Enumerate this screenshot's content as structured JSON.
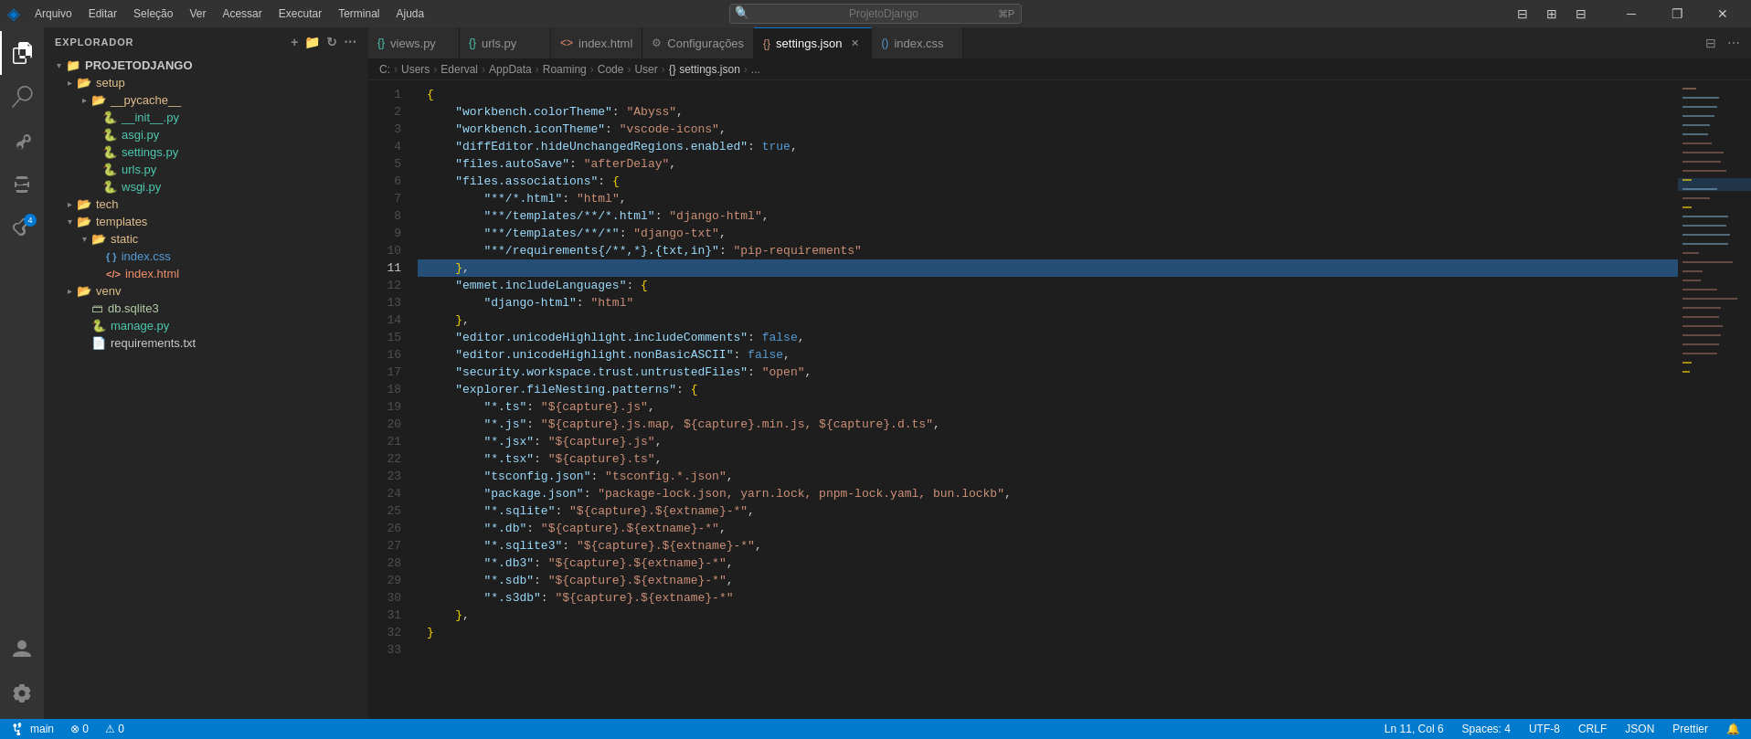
{
  "titlebar": {
    "logo": "◈",
    "menu_items": [
      "Arquivo",
      "Editar",
      "Seleção",
      "Ver",
      "Acessar",
      "Executar",
      "Terminal",
      "Ajuda"
    ],
    "search_placeholder": "ProjetoDjango",
    "win_minimize": "─",
    "win_restore": "❐",
    "win_close": "✕"
  },
  "activity_bar": {
    "icons": [
      {
        "name": "explorer-icon",
        "symbol": "⎗",
        "active": true
      },
      {
        "name": "search-icon",
        "symbol": "🔍",
        "active": false
      },
      {
        "name": "source-control-icon",
        "symbol": "⎇",
        "active": false
      },
      {
        "name": "run-debug-icon",
        "symbol": "▷",
        "active": false
      },
      {
        "name": "extensions-icon",
        "symbol": "⊞",
        "active": false,
        "badge": "4"
      }
    ],
    "bottom_icons": [
      {
        "name": "accounts-icon",
        "symbol": "👤"
      },
      {
        "name": "settings-icon",
        "symbol": "⚙"
      }
    ]
  },
  "sidebar": {
    "header": "EXPLORADOR",
    "header_actions": [
      "⋯"
    ],
    "project_name": "PROJETODJANGO",
    "tree": [
      {
        "id": "setup",
        "label": "setup",
        "type": "folder",
        "depth": 1,
        "expanded": false
      },
      {
        "id": "pycache",
        "label": "__pycache__",
        "type": "folder",
        "depth": 2,
        "expanded": false
      },
      {
        "id": "init",
        "label": "__init__.py",
        "type": "py",
        "depth": 2
      },
      {
        "id": "asgi",
        "label": "asgi.py",
        "type": "py",
        "depth": 2
      },
      {
        "id": "settings",
        "label": "settings.py",
        "type": "py",
        "depth": 2
      },
      {
        "id": "urls",
        "label": "urls.py",
        "type": "py",
        "depth": 2
      },
      {
        "id": "wsgi",
        "label": "wsgi.py",
        "type": "py",
        "depth": 2
      },
      {
        "id": "tech",
        "label": "tech",
        "type": "folder",
        "depth": 1,
        "expanded": false
      },
      {
        "id": "templates",
        "label": "templates",
        "type": "folder",
        "depth": 1,
        "expanded": true
      },
      {
        "id": "static",
        "label": "static",
        "type": "folder",
        "depth": 2,
        "expanded": true
      },
      {
        "id": "indexcss",
        "label": "index.css",
        "type": "css",
        "depth": 3
      },
      {
        "id": "indexhtml",
        "label": "index.html",
        "type": "html",
        "depth": 3
      },
      {
        "id": "venv",
        "label": "venv",
        "type": "folder",
        "depth": 1,
        "expanded": false
      },
      {
        "id": "dbsqlite3",
        "label": "db.sqlite3",
        "type": "db",
        "depth": 1
      },
      {
        "id": "managepy",
        "label": "manage.py",
        "type": "py",
        "depth": 1
      },
      {
        "id": "requirementstxt",
        "label": "requirements.txt",
        "type": "txt",
        "depth": 1
      }
    ]
  },
  "tabs": [
    {
      "id": "views",
      "label": "views.py",
      "icon": "{}",
      "active": false,
      "dirty": false
    },
    {
      "id": "urls",
      "label": "urls.py",
      "icon": "{}",
      "active": false,
      "dirty": false
    },
    {
      "id": "indexhtml",
      "label": "index.html",
      "icon": "<>",
      "active": false,
      "dirty": false
    },
    {
      "id": "configuracoes",
      "label": "Configurações",
      "icon": "⚙",
      "active": false,
      "dirty": false
    },
    {
      "id": "settingsjson",
      "label": "settings.json",
      "icon": "{}",
      "active": true,
      "dirty": false
    },
    {
      "id": "indexcss",
      "label": "index.css",
      "icon": "()",
      "active": false,
      "dirty": false
    }
  ],
  "breadcrumb": {
    "parts": [
      "C:",
      "Users",
      "Ederval",
      "AppData",
      "Roaming",
      "Code",
      "User",
      "{} settings.json",
      "..."
    ]
  },
  "code": {
    "lines": [
      {
        "num": 1,
        "content": "{",
        "highlighted": false
      },
      {
        "num": 2,
        "content": "    \"workbench.colorTheme\": \"Abyss\",",
        "highlighted": false
      },
      {
        "num": 3,
        "content": "    \"workbench.iconTheme\": \"vscode-icons\",",
        "highlighted": false
      },
      {
        "num": 4,
        "content": "    \"diffEditor.hideUnchangedRegions.enabled\": true,",
        "highlighted": false
      },
      {
        "num": 5,
        "content": "    \"files.autoSave\": \"afterDelay\",",
        "highlighted": false
      },
      {
        "num": 6,
        "content": "    \"files.associations\": {",
        "highlighted": false
      },
      {
        "num": 7,
        "content": "        \"**/*.html\": \"html\",",
        "highlighted": false
      },
      {
        "num": 8,
        "content": "        \"**/templates/**/*.html\": \"django-html\",",
        "highlighted": false
      },
      {
        "num": 9,
        "content": "        \"**/templates/**/*\": \"django-txt\",",
        "highlighted": false
      },
      {
        "num": 10,
        "content": "        \"**/requirements{/**,*}.{txt,in}\": \"pip-requirements\"",
        "highlighted": false
      },
      {
        "num": 11,
        "content": "    },",
        "highlighted": true
      },
      {
        "num": 12,
        "content": "    \"emmet.includeLanguages\": {",
        "highlighted": false
      },
      {
        "num": 13,
        "content": "        \"django-html\": \"html\"",
        "highlighted": false
      },
      {
        "num": 14,
        "content": "    },",
        "highlighted": false
      },
      {
        "num": 15,
        "content": "    \"editor.unicodeHighlight.includeComments\": false,",
        "highlighted": false
      },
      {
        "num": 16,
        "content": "    \"editor.unicodeHighlight.nonBasicASCII\": false,",
        "highlighted": false
      },
      {
        "num": 17,
        "content": "    \"security.workspace.trust.untrustedFiles\": \"open\",",
        "highlighted": false
      },
      {
        "num": 18,
        "content": "    \"explorer.fileNesting.patterns\": {",
        "highlighted": false
      },
      {
        "num": 19,
        "content": "        \"*.ts\": \"${capture}.js\",",
        "highlighted": false
      },
      {
        "num": 20,
        "content": "        \"*.js\": \"${capture}.js.map, ${capture}.min.js, ${capture}.d.ts\",",
        "highlighted": false
      },
      {
        "num": 21,
        "content": "        \"*.jsx\": \"${capture}.js\",",
        "highlighted": false
      },
      {
        "num": 22,
        "content": "        \"*.tsx\": \"${capture}.ts\",",
        "highlighted": false
      },
      {
        "num": 23,
        "content": "        \"tsconfig.json\": \"tsconfig.*.json\",",
        "highlighted": false
      },
      {
        "num": 24,
        "content": "        \"package.json\": \"package-lock.json, yarn.lock, pnpm-lock.yaml, bun.lockb\",",
        "highlighted": false
      },
      {
        "num": 25,
        "content": "        \"*.sqlite\": \"${capture}.${extname}-*\",",
        "highlighted": false
      },
      {
        "num": 26,
        "content": "        \"*.db\": \"${capture}.${extname}-*\",",
        "highlighted": false
      },
      {
        "num": 27,
        "content": "        \"*.sqlite3\": \"${capture}.${extname}-*\",",
        "highlighted": false
      },
      {
        "num": 28,
        "content": "        \"*.db3\": \"${capture}.${extname}-*\",",
        "highlighted": false
      },
      {
        "num": 29,
        "content": "        \"*.sdb\": \"${capture}.${extname}-*\",",
        "highlighted": false
      },
      {
        "num": 30,
        "content": "        \"*.s3db\": \"${capture}.${extname}-*\"",
        "highlighted": false
      },
      {
        "num": 31,
        "content": "    },",
        "highlighted": false
      },
      {
        "num": 32,
        "content": "}",
        "highlighted": false
      },
      {
        "num": 33,
        "content": "",
        "highlighted": false
      }
    ]
  },
  "status_bar": {
    "left": [
      "⎇ main",
      "⚠ 0",
      "✗ 0"
    ],
    "right": [
      "Ln 11, Col 6",
      "Spaces: 4",
      "UTF-8",
      "CRLF",
      "JSON",
      "Formatador: Prettier",
      "⚡"
    ]
  }
}
